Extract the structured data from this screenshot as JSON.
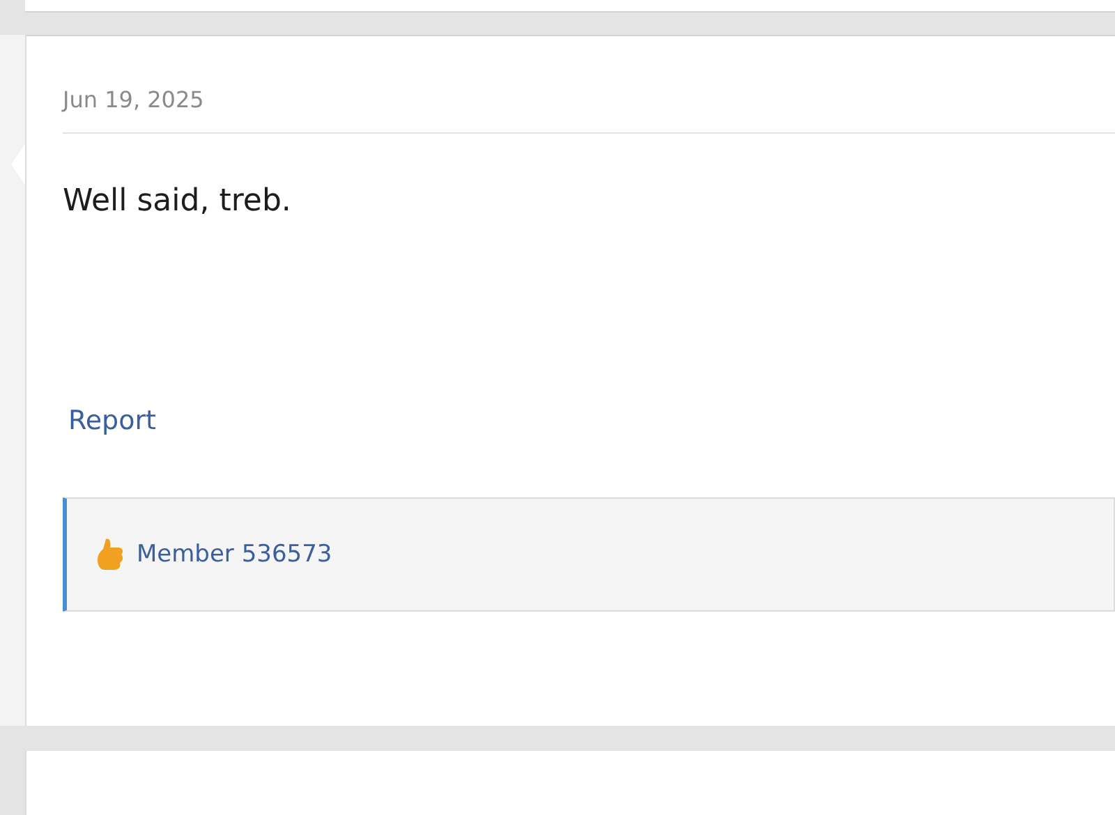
{
  "post": {
    "date": "Jun 19, 2025",
    "message": "Well said, treb.",
    "report_link": "Report",
    "reactions": {
      "users": "Member 536573"
    }
  }
}
